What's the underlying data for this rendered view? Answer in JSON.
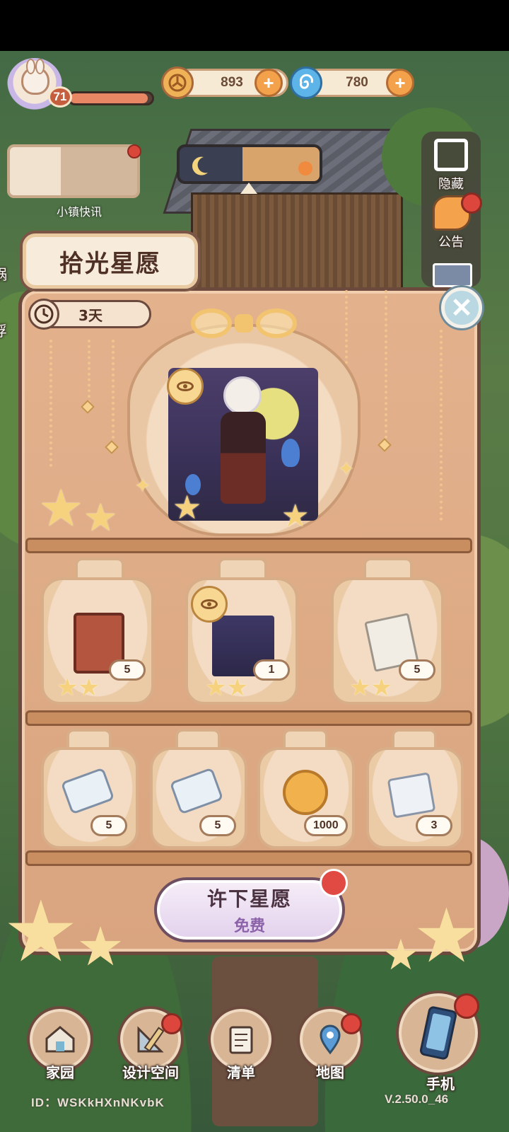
{
  "hud": {
    "level": "71",
    "xp_fraction": 0.95,
    "currency_gold": "893",
    "currency_spiral": "780",
    "plus": "+"
  },
  "news": {
    "label": "小镇快讯"
  },
  "side": {
    "hide_label": "隐藏",
    "notice_label": "公告"
  },
  "left_edge": {
    "snail": "蜗",
    "float": "浮"
  },
  "event": {
    "title": "拾光星愿",
    "timer": "3天",
    "close": "✕"
  },
  "rewards_row1": [
    {
      "name": "book",
      "count": "5"
    },
    {
      "name": "mount-card",
      "count": "1"
    },
    {
      "name": "blueprint-scroll",
      "count": "5"
    }
  ],
  "rewards_row2": [
    {
      "name": "ticket",
      "count": "5"
    },
    {
      "name": "refresh-ticket",
      "count": "5"
    },
    {
      "name": "coin",
      "count": "1000"
    },
    {
      "name": "calendar-fish",
      "count": "3"
    }
  ],
  "wish_button": {
    "label": "许下星愿",
    "sub": "免费"
  },
  "nav": {
    "home": "家园",
    "design": "设计空间",
    "list": "清单",
    "map": "地图",
    "phone": "手机"
  },
  "footer": {
    "id": "ID：WSKkHXnNKvbK",
    "version": "V.2.50.0_46"
  },
  "colors": {
    "panel": "#d9a480",
    "accent_red": "#dc463d",
    "wish_purple": "#8c63a8"
  }
}
